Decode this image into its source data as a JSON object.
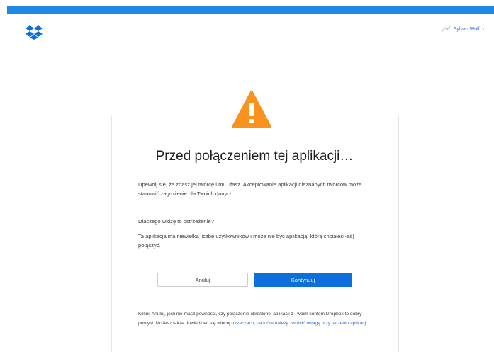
{
  "header": {
    "user_name": "Sylvan Wolf",
    "user_chevron": "›"
  },
  "icons": {
    "logo": "dropbox-logo",
    "warning": "warning-triangle-icon"
  },
  "colors": {
    "accent_bar": "#1e88e5",
    "brand_blue": "#0d6fdc",
    "warning_orange": "#f7931e",
    "link": "#2d6bd6"
  },
  "dialog": {
    "title": "Przed połączeniem tej aplikacji…",
    "paragraph_1": "Upewnij się, że znasz jej twórcę i mu ufasz. Akceptowanie aplikacji nieznanych twórców może stanowić zagrożenie dla Twoich danych.",
    "question": "Dlaczego widzę to ostrzeżenie?",
    "paragraph_2": "Ta aplikacja ma niewielką liczbę użytkowników i może nie być aplikacją, którą chciałeś(-aś) połączyć.",
    "cancel_label": "Anuluj",
    "continue_label": "Kontynuuj",
    "footer_text": "Kliknij Anuluj, jeśli nie masz pewności, czy połączenie określonej aplikacji z Twoim kontem Dropbox to dobry pomysł. Możesz także dowiedzieć się więcej o ",
    "footer_link": "rzeczach, na które należy zwrócić uwagę przy łączeniu aplikacji."
  }
}
